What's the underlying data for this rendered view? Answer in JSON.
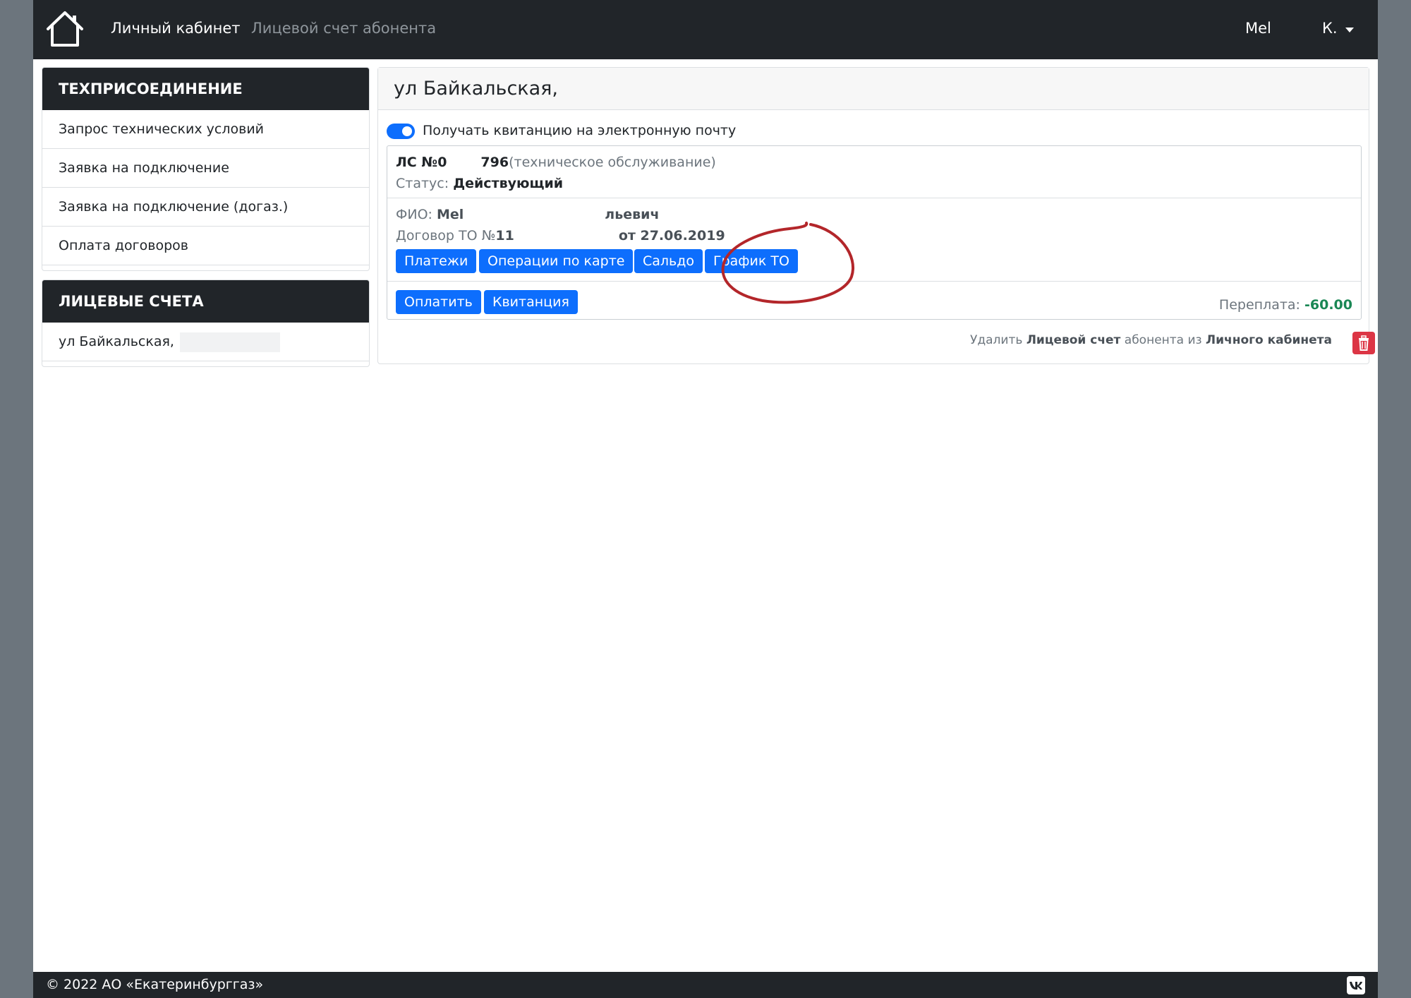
{
  "nav": {
    "brand": "Личный кабинет",
    "link": "Лицевой счет абонента",
    "user_short": "Меl",
    "user_menu": "К."
  },
  "sidebar": {
    "techconnect": {
      "title": "ТЕХПРИСОЕДИНЕНИЕ",
      "items": [
        "Запрос технических условий",
        "Заявка на подключение",
        "Заявка на подключение (догаз.)",
        "Оплата договоров"
      ]
    },
    "accounts": {
      "title": "ЛИЦЕВЫЕ СЧЕТА",
      "items": [
        "ул Байкальская,"
      ]
    }
  },
  "main": {
    "title": "ул Байкальская,",
    "email_toggle_label": "Получать квитанцию на электронную почту",
    "email_toggle_on": true,
    "account": {
      "number_label": "ЛС №0",
      "number_value": "796",
      "type": "(техническое обслуживание)",
      "status_label": "Статус:",
      "status_value": "Действующий",
      "fio_label": "ФИО:",
      "fio_part1": "Меl",
      "fio_part2": "льевич",
      "contract_label": "Договор ТО №",
      "contract_number": "11",
      "contract_date": "от 27.06.2019",
      "buttons": [
        "Платежи",
        "Операции по карте",
        "Сальдо",
        "График ТО"
      ],
      "pay_button": "Оплатить",
      "receipt_button": "Квитанция",
      "overpay_label": "Переплата:",
      "overpay_value": "-60.00"
    },
    "delete": {
      "prefix": "Удалить",
      "bold1": "Лицевой счет",
      "middle": "абонента из",
      "bold2": "Личного кабинета"
    }
  },
  "footer": {
    "copyright": "© 2022 АО «Екатеринбурггаз»"
  },
  "colors": {
    "navbar": "#212529",
    "primary": "#0d6efd",
    "success": "#198754",
    "danger": "#dc3545",
    "annotation": "#b3262a"
  }
}
